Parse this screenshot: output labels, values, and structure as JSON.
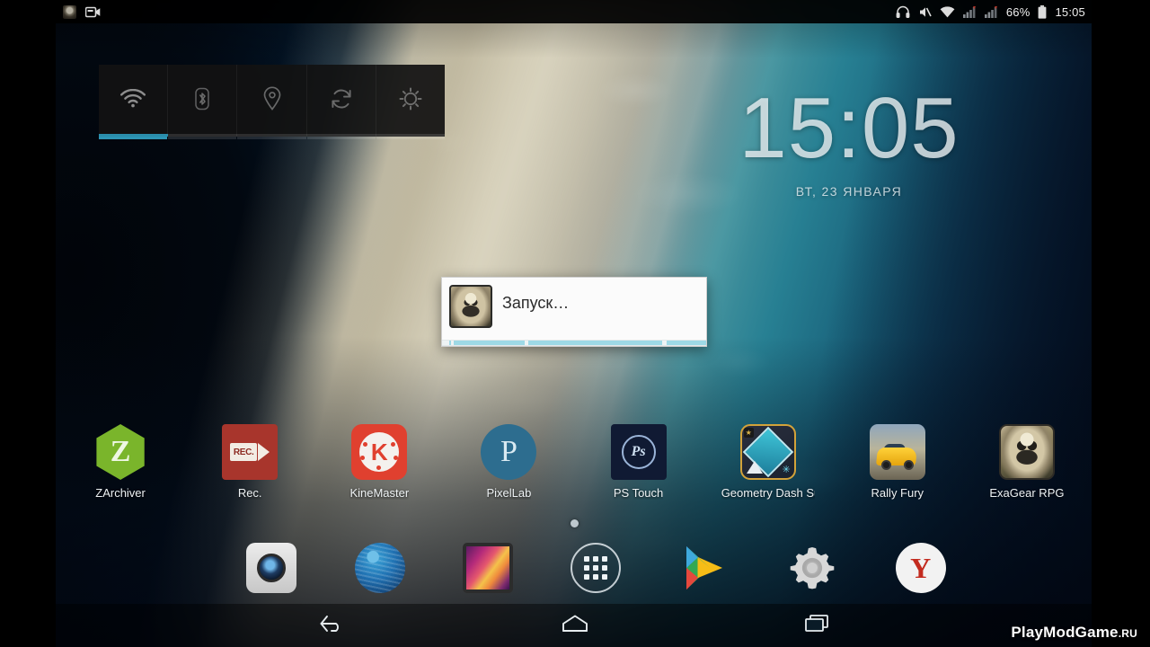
{
  "status_bar": {
    "notifications": [
      {
        "name": "exagear-notification-icon",
        "label": "ExaGear"
      },
      {
        "name": "screen-recorder-icon",
        "label": "Rec"
      }
    ],
    "right_icons": [
      {
        "name": "headset-icon",
        "glyph": "headset"
      },
      {
        "name": "mute-icon",
        "glyph": "mute"
      },
      {
        "name": "wifi-icon",
        "glyph": "wifi"
      },
      {
        "name": "signal-sim1-icon",
        "glyph": "signal"
      },
      {
        "name": "signal-sim2-icon",
        "glyph": "signal"
      }
    ],
    "battery_percent": "66%",
    "clock": "15:05"
  },
  "quick_settings": {
    "toggles": [
      {
        "name": "wifi-toggle",
        "icon": "wifi-icon",
        "active": true
      },
      {
        "name": "bluetooth-toggle",
        "icon": "bluetooth-icon",
        "active": false
      },
      {
        "name": "location-toggle",
        "icon": "location-pin-icon",
        "active": false
      },
      {
        "name": "sync-toggle",
        "icon": "sync-icon",
        "active": false
      },
      {
        "name": "brightness-toggle",
        "icon": "brightness-sun-icon",
        "active": false
      }
    ]
  },
  "clock_widget": {
    "time": "15:05",
    "date": "ВТ, 23 ЯНВАРЯ"
  },
  "launch_dialog": {
    "title": "Запуск…",
    "icon": "exagear-app-icon",
    "progress_indeterminate": true
  },
  "home_screen": {
    "apps": [
      {
        "label": "ZArchiver",
        "icon": "zarchiver-icon"
      },
      {
        "label": "Rec.",
        "icon": "screen-recorder-icon"
      },
      {
        "label": "KineMaster",
        "icon": "kinemaster-icon"
      },
      {
        "label": "PixelLab",
        "icon": "pixellab-icon"
      },
      {
        "label": "PS Touch",
        "icon": "photoshop-touch-icon"
      },
      {
        "label": "Geometry Dash SubZ",
        "icon": "geometry-dash-subzero-icon"
      },
      {
        "label": "Rally Fury",
        "icon": "rally-fury-icon"
      },
      {
        "label": "ExaGear RPG",
        "icon": "exagear-rpg-icon"
      }
    ],
    "page_indicator": {
      "pages": 1,
      "current": 1
    }
  },
  "dock": {
    "items": [
      {
        "label": "Camera",
        "icon": "camera-icon"
      },
      {
        "label": "Browser",
        "icon": "browser-globe-icon"
      },
      {
        "label": "Gallery",
        "icon": "gallery-icon"
      },
      {
        "label": "Apps",
        "icon": "app-drawer-icon"
      },
      {
        "label": "Play Store",
        "icon": "play-store-icon"
      },
      {
        "label": "Settings",
        "icon": "settings-gear-icon"
      },
      {
        "label": "Yandex",
        "icon": "yandex-browser-icon"
      }
    ]
  },
  "nav_bar": {
    "buttons": [
      {
        "name": "back-button",
        "icon": "back-arrow-icon"
      },
      {
        "name": "home-button",
        "icon": "home-icon"
      },
      {
        "name": "recents-button",
        "icon": "recents-icon"
      }
    ]
  },
  "watermark": {
    "text": "PlayModGame",
    "tld": ".RU"
  },
  "colors": {
    "accent_blue": "#2d95b5",
    "progress_fill": "#9ed9e6",
    "dialog_bg": "#fbfbfb",
    "status_bar_bg": "#000000"
  }
}
